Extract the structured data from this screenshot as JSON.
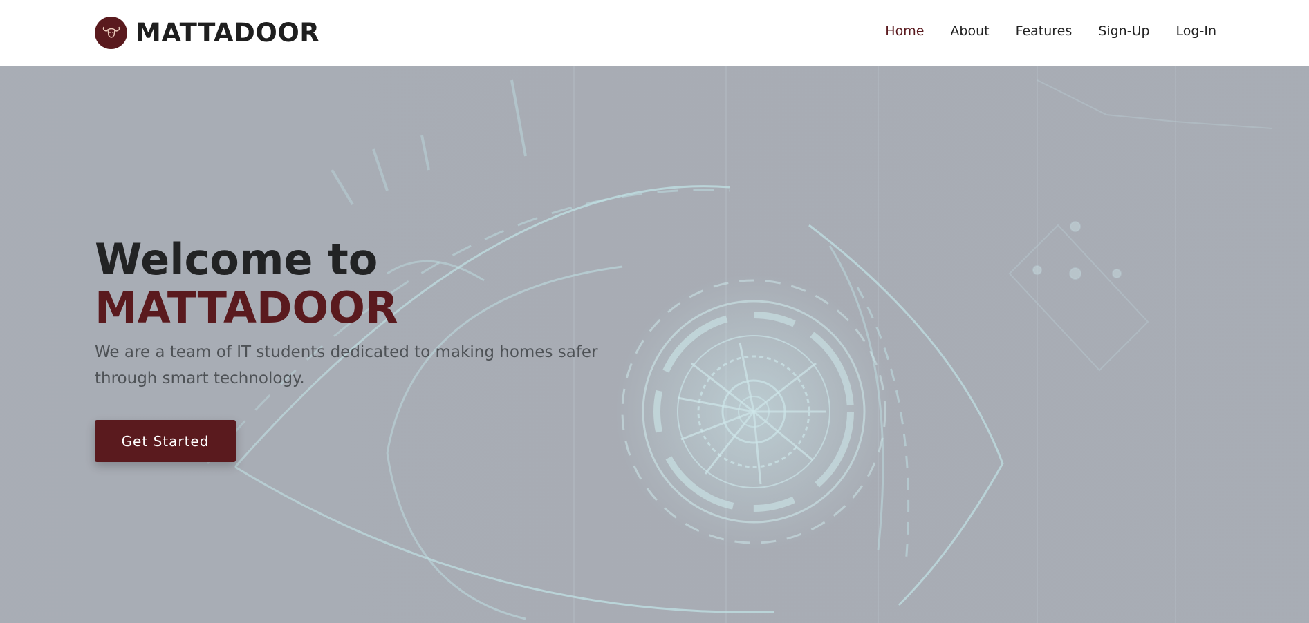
{
  "brand": {
    "name": "MATTADOOR",
    "logo_icon": "bull-icon"
  },
  "nav": {
    "items": [
      {
        "label": "Home",
        "active": true
      },
      {
        "label": "About"
      },
      {
        "label": "Features"
      },
      {
        "label": "Sign-Up"
      },
      {
        "label": "Log-In"
      }
    ]
  },
  "hero": {
    "title_line1": "Welcome to",
    "title_line2": "MATTADOOR",
    "subtitle": "We are a team of IT students dedicated to making homes safer through smart technology.",
    "cta_label": "Get Started",
    "background_image": "futuristic-eye-illustration"
  },
  "colors": {
    "brand": "#5a1a1e",
    "nav_text": "#222222",
    "hero_bg": "#a6abb3",
    "eye_lines": "#c8f4f6"
  }
}
